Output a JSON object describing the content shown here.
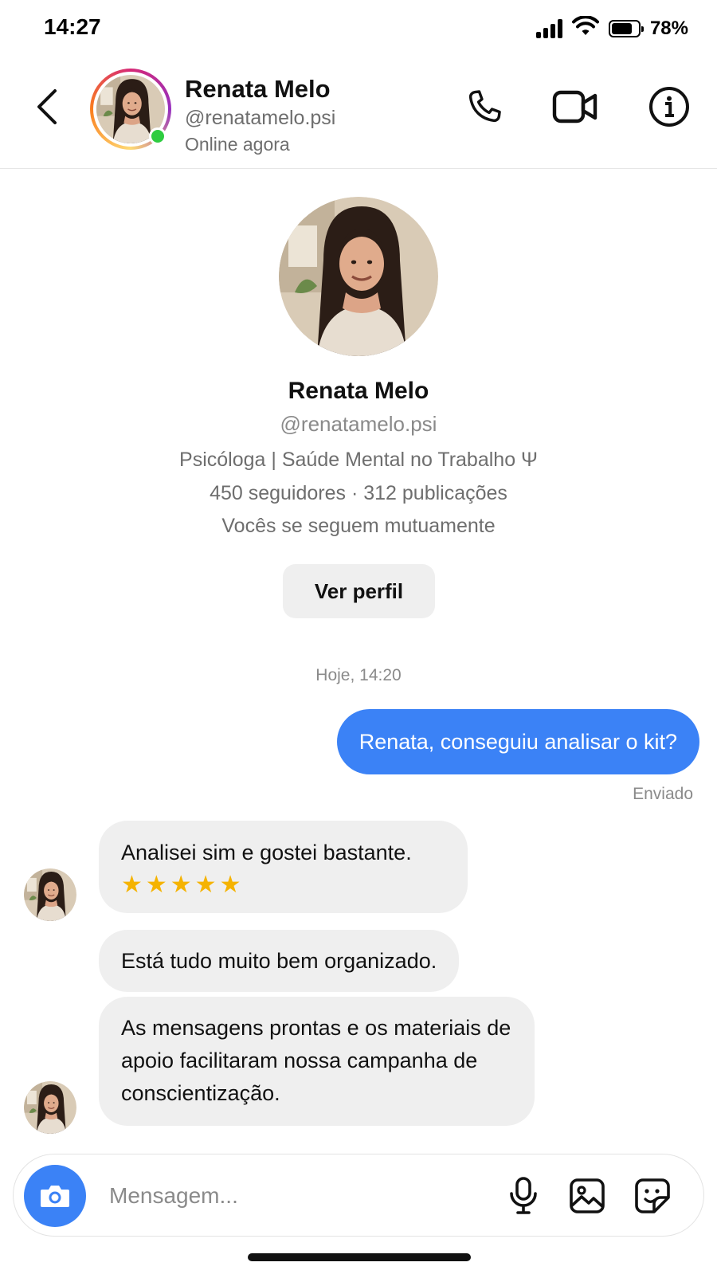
{
  "status_bar": {
    "time": "14:27",
    "battery_percent": "78%",
    "battery_level": 0.78,
    "icons": [
      "signal-icon",
      "wifi-icon",
      "battery-icon"
    ]
  },
  "header": {
    "name": "Renata Melo",
    "handle": "@renatamelo.psi",
    "status": "Online agora",
    "icons": [
      "back-arrow-icon",
      "phone-icon",
      "video-camera-icon",
      "info-icon"
    ],
    "online": true
  },
  "profile": {
    "name": "Renata Melo",
    "handle": "@renatamelo.psi",
    "bio": "Psicóloga | Saúde Mental no Trabalho Ψ",
    "stats": "450 seguidores · 312 publicações",
    "mutual": "Vocês se seguem mutuamente",
    "view_profile_label": "Ver perfil"
  },
  "conversation": {
    "timestamp": "Hoje, 14:20",
    "outgoing": [
      {
        "text": "Renata, conseguiu analisar o kit?",
        "status": "Enviado"
      }
    ],
    "incoming": [
      {
        "text": "Analisei sim e gostei bastante.",
        "stars": "★★★★★",
        "rating": 5
      },
      {
        "text": "Está tudo muito bem organizado."
      },
      {
        "text": "As mensagens prontas e os materiais de apoio facilitaram nossa campanha de conscientização."
      }
    ]
  },
  "composer": {
    "placeholder": "Mensagem...",
    "icons": [
      "camera-icon",
      "microphone-icon",
      "gallery-icon",
      "sticker-icon"
    ]
  },
  "colors": {
    "accent": "#3b82f6",
    "incoming_bubble": "#efefef",
    "online": "#2ecc40",
    "star": "#f5b301"
  }
}
